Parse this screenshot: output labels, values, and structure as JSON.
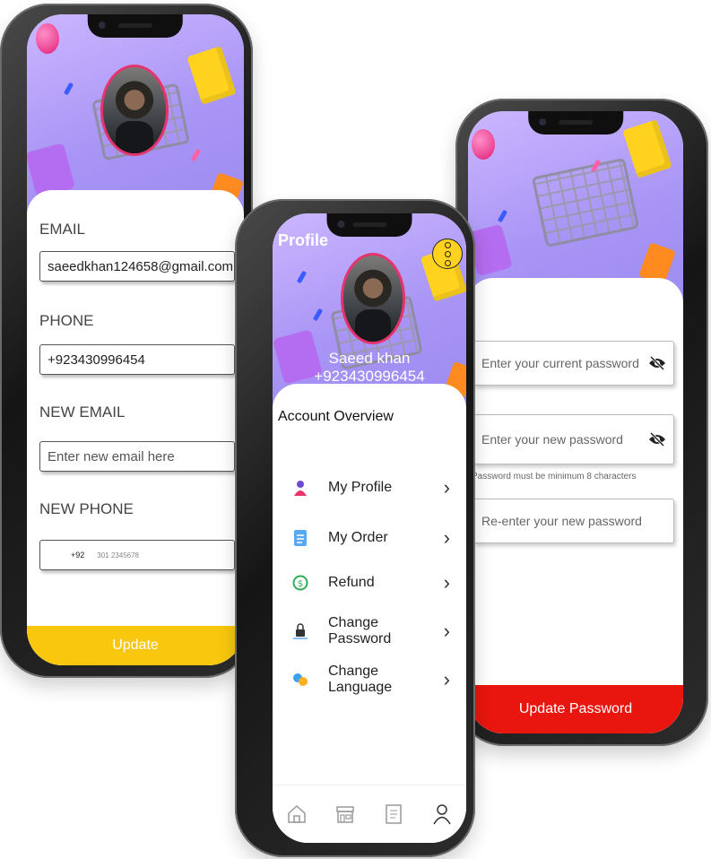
{
  "left_phone": {
    "email_label": "EMAIL",
    "email_value": "saeedkhan124658@gmail.com",
    "phone_label": "PHONE",
    "phone_value": "+923430996454",
    "new_email_label": "NEW EMAIL",
    "new_email_placeholder": "Enter new email here",
    "new_phone_label": "NEW PHONE",
    "country_code": "+92",
    "phone_placeholder": "301 2345678",
    "update_button": "Update",
    "update_color": "#f9c80e"
  },
  "center_phone": {
    "title": "Profile",
    "user_name": "Saeed khan",
    "user_phone": "+923430996454",
    "section_title": "Account Overview",
    "menu": [
      {
        "label": "My Profile",
        "icon": "person-icon"
      },
      {
        "label": "My Order",
        "icon": "order-icon"
      },
      {
        "label": "Refund",
        "icon": "refund-icon"
      },
      {
        "label": "Change Password",
        "icon": "lock-icon"
      },
      {
        "label": "Change Language",
        "icon": "language-icon"
      }
    ],
    "nav": [
      "home-icon",
      "store-icon",
      "orders-icon",
      "profile-icon"
    ]
  },
  "right_phone": {
    "current_password_placeholder": "Enter your current password",
    "new_password_placeholder": "Enter your new password",
    "password_hint": "Password must be minimum 8 characters",
    "reenter_placeholder": "Re-enter your new password",
    "update_button": "Update Password",
    "update_color": "#e8160f"
  }
}
